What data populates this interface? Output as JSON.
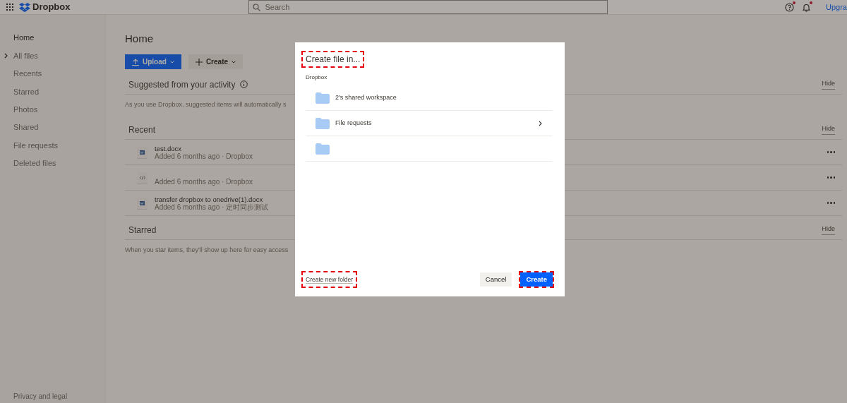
{
  "topbar": {
    "brand": "Dropbox",
    "search": {
      "placeholder": "Search"
    },
    "notifications": [
      {
        "kind": "help",
        "unread": true
      },
      {
        "kind": "bell",
        "unread": true
      }
    ],
    "upgrade": "Upgra"
  },
  "sidebar": {
    "items": [
      {
        "label": "Home",
        "selected": true,
        "expandable": false
      },
      {
        "label": "All files",
        "selected": false,
        "expandable": true
      },
      {
        "label": "Recents",
        "selected": false,
        "expandable": false
      },
      {
        "label": "Starred",
        "selected": false,
        "expandable": false
      },
      {
        "label": "Photos",
        "selected": false,
        "expandable": false
      },
      {
        "label": "Shared",
        "selected": false,
        "expandable": false
      },
      {
        "label": "File requests",
        "selected": false,
        "expandable": false
      },
      {
        "label": "Deleted files",
        "selected": false,
        "expandable": false
      }
    ],
    "footer": "Privacy and legal"
  },
  "main": {
    "title": "Home",
    "actions": [
      {
        "label": "Upload",
        "kind": "primary"
      },
      {
        "label": "Create",
        "kind": "secondary"
      }
    ],
    "sections": [
      {
        "title": "Suggested from your activity",
        "info": true,
        "hide": "Hide",
        "note": "As you use Dropbox, suggested items will automatically s"
      },
      {
        "title": "Recent",
        "info": false,
        "hide": "Hide",
        "files": [
          {
            "kind": "word",
            "name": "test.docx",
            "meta": "Added 6 months ago · Dropbox"
          },
          {
            "kind": "code",
            "meta": "Added 6 months ago · Dropbox"
          },
          {
            "kind": "word",
            "name": "transfer dropbox to onedrive(1).docx",
            "meta": "Added 6 months ago · 定时同步测试"
          }
        ]
      },
      {
        "title": "Starred",
        "info": false,
        "hide": "Hide",
        "note": "When you star items, they'll show up here for easy access"
      }
    ]
  },
  "dialog": {
    "title": {
      "text": "Create file in...",
      "highlighted": true
    },
    "location": "Dropbox",
    "folders": [
      {
        "name": "2's shared workspace",
        "has_children": false
      },
      {
        "name": "File requests",
        "has_children": true
      },
      {
        "has_children": false
      }
    ],
    "new_folder": {
      "label": "Create new folder",
      "highlighted": true
    },
    "buttons": [
      {
        "label": "Cancel",
        "kind": "secondary",
        "highlighted": false
      },
      {
        "label": "Create",
        "kind": "primary",
        "highlighted": true
      }
    ]
  }
}
